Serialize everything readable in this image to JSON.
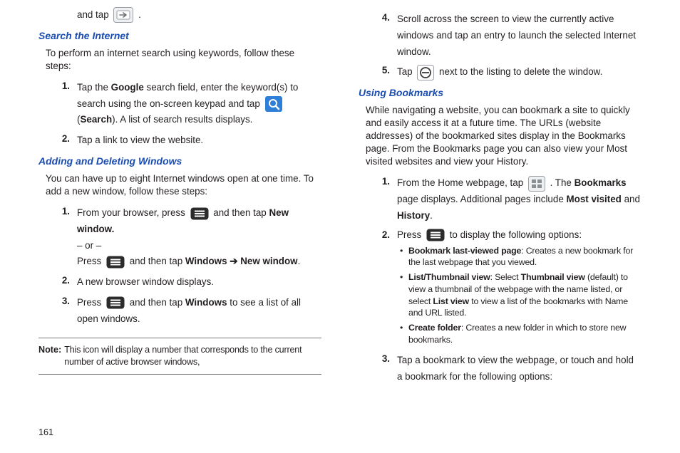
{
  "page_number": "161",
  "nums": [
    "1.",
    "2.",
    "3.",
    "4.",
    "5."
  ],
  "left": {
    "tap_intro_pre": "and tap ",
    "tap_intro_post": " .",
    "h1": "Search the Internet",
    "search_intro": "To perform an internet search using keywords, follow these steps:",
    "s1": {
      "a": "Tap the ",
      "b": "Google",
      "c": " search field, enter the keyword(s) to search using the on-screen keypad and tap ",
      "d": " (",
      "e": "Search",
      "f": "). A list of search results displays."
    },
    "s2": "Tap a link to view the website.",
    "h2": "Adding and Deleting Windows",
    "win_intro": "You can have up to eight Internet windows open at one time. To add a new window, follow these steps:",
    "w1": {
      "a": "From your browser, press ",
      "b": " and then tap ",
      "c": "New window.",
      "or": "– or –",
      "d": "Press ",
      "e": " and then tap ",
      "f": "Windows ",
      "arrow": "➔ ",
      "g": "New window",
      "h": "."
    },
    "w2": "A new browser window displays.",
    "w3": {
      "a": "Press ",
      "b": " and then tap ",
      "c": "Windows",
      "d": " to see a list of all open windows."
    },
    "note": {
      "label": "Note:",
      "text": "This icon will display a number that corresponds to the current number of active browser windows,"
    }
  },
  "right": {
    "r4": "Scroll across the screen to view the currently active windows and tap an entry to launch the selected Internet window.",
    "r5": {
      "a": "Tap ",
      "b": " next to the listing to delete the window."
    },
    "h1": "Using Bookmarks",
    "bm_intro": "While navigating a website, you can bookmark a site to quickly and easily access it at a future time. The URLs (website addresses) of the bookmarked sites display in the Bookmarks page. From the Bookmarks page you can also view your Most visited websites and view your History.",
    "b1": {
      "a": "From the Home webpage, tap ",
      "b": " . The ",
      "c": "Bookmarks",
      "d": " page displays. Additional pages include ",
      "e": "Most visited",
      "f": " and ",
      "g": "History",
      "h": "."
    },
    "b2": {
      "a": "Press ",
      "b": " to display the following options:",
      "ul": [
        {
          "t": "Bookmark last-viewed page",
          "d": ": Creates a new bookmark for the last webpage that you viewed."
        },
        {
          "t": "List/Thumbnail view",
          "d1": ": Select ",
          "t2": "Thumbnail view",
          "d2": " (default) to view a thumbnail of the webpage with the name listed, or select ",
          "t3": "List view",
          "d3": " to view a list of the bookmarks with Name and URL listed."
        },
        {
          "t": "Create folder",
          "d": ": Creates a new folder in which to store new bookmarks."
        }
      ]
    },
    "b3": "Tap a bookmark to view the webpage, or touch and hold a bookmark for the following options:"
  }
}
